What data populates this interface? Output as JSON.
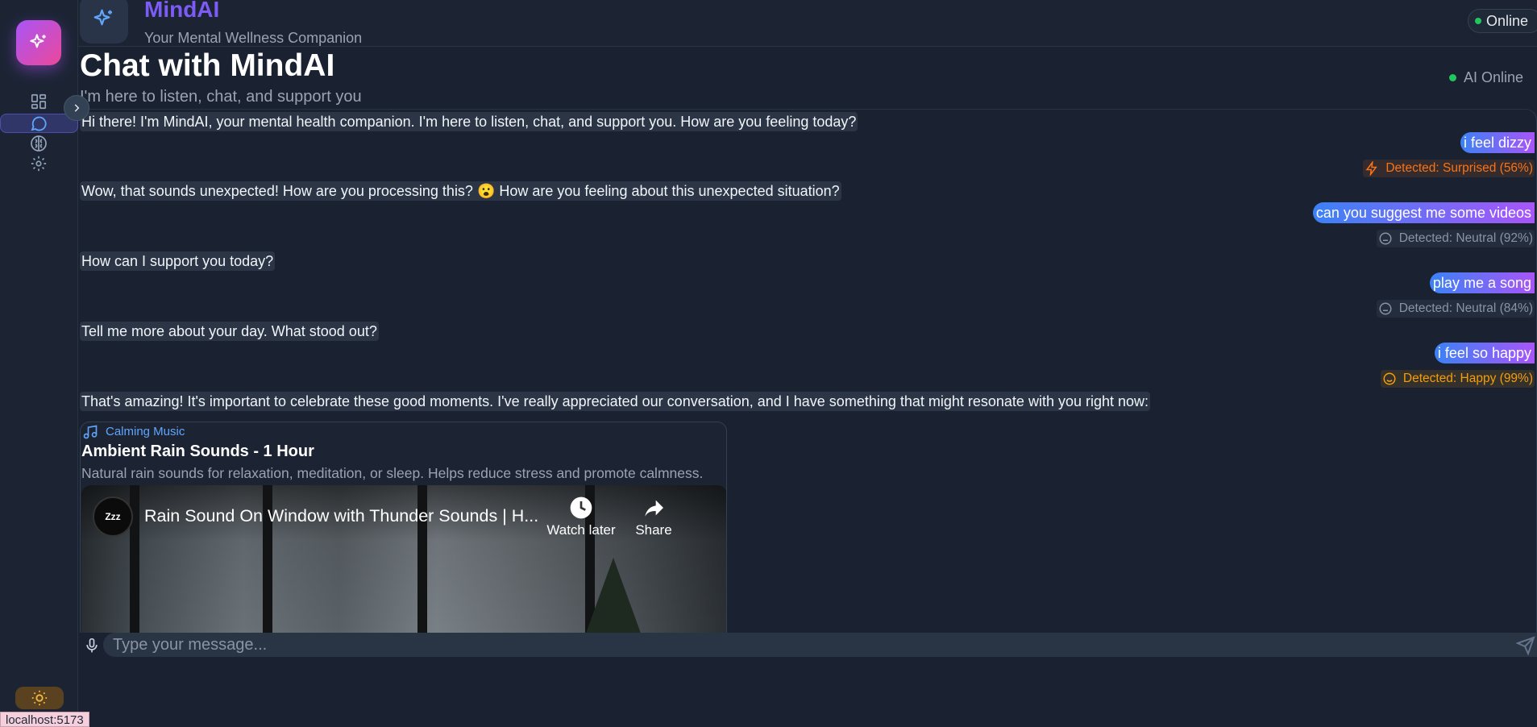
{
  "app": {
    "name": "MindAI",
    "tagline": "Your Mental Wellness Companion",
    "status": "Online"
  },
  "sidebar": {
    "items": [
      {
        "name": "dashboard",
        "icon": "grid-icon"
      },
      {
        "name": "chat",
        "icon": "chat-bubble-icon",
        "active": true
      },
      {
        "name": "insights",
        "icon": "brain-icon"
      },
      {
        "name": "settings",
        "icon": "gear-icon"
      }
    ],
    "theme_icon": "sun-icon"
  },
  "chat": {
    "title": "Chat with MindAI",
    "subtitle": "I'm here to listen, chat, and support you",
    "ai_status": "AI Online"
  },
  "messages": [
    {
      "role": "bot",
      "text": "Hi there! I'm MindAI, your mental health companion. I'm here to listen, chat, and support you. How are you feeling today?"
    },
    {
      "role": "user",
      "text": "i feel dizzy",
      "emotion": "Detected: Surprised (56%)",
      "emotion_type": "surprised"
    },
    {
      "role": "bot",
      "text": "Wow, that sounds unexpected! How are you processing this? 😮 How are you feeling about this unexpected situation?"
    },
    {
      "role": "user",
      "text": "can you suggest me some videos",
      "emotion": "Detected: Neutral (92%)",
      "emotion_type": "neutral"
    },
    {
      "role": "bot",
      "text": "How can I support you today?"
    },
    {
      "role": "user",
      "text": "play me a song",
      "emotion": "Detected: Neutral (84%)",
      "emotion_type": "neutral"
    },
    {
      "role": "bot",
      "text": "Tell me more about your day. What stood out?"
    },
    {
      "role": "user",
      "text": "i feel so happy",
      "emotion": "Detected: Happy (99%)",
      "emotion_type": "happy"
    },
    {
      "role": "bot",
      "text": "That's amazing! It's important to celebrate these good moments. I've really appreciated our conversation, and I have something that might resonate with you right now:"
    }
  ],
  "media_card": {
    "category": "Calming Music",
    "title": "Ambient Rain Sounds - 1 Hour",
    "description": "Natural rain sounds for relaxation, meditation, or sleep. Helps reduce stress and promote calmness.",
    "video": {
      "title": "Rain Sound On Window with Thunder Sounds | H...",
      "channel_avatar": "Zzz",
      "watch_later": "Watch later",
      "share": "Share"
    }
  },
  "input": {
    "placeholder": "Type your message..."
  },
  "statusbar": {
    "url": "localhost:5173"
  },
  "colors": {
    "background": "#1a2232",
    "accent_gradient_start": "#3b82f6",
    "accent_gradient_end": "#a855f7",
    "surprised": "#f97316",
    "neutral": "#8a93a3",
    "happy": "#f59e0b",
    "online": "#22c55e"
  }
}
